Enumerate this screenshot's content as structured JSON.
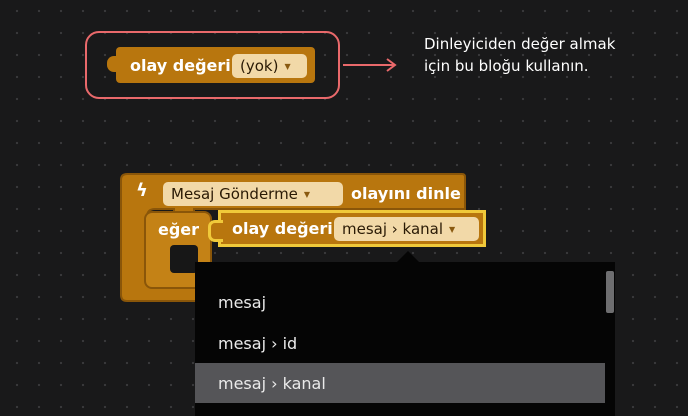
{
  "hint": {
    "block_label": "olay değeri",
    "block_value": "(yok)",
    "help_text": "Dinleyiciden değer almak için bu bloğu kullanın."
  },
  "event_block": {
    "event_name": "Mesaj Gönderme",
    "event_suffix": "olayını dinle",
    "if_label": "eğer",
    "value_label": "olay değeri",
    "value_selected": "mesaj › kanal"
  },
  "dropdown": {
    "options": [
      "mesaj",
      "mesaj › id",
      "mesaj › kanal"
    ],
    "selected_index": 2
  },
  "colors": {
    "block": "#b8760e",
    "block_dark": "#8a5609",
    "field": "#f2d9a8",
    "highlight_outline": "#f0c93a",
    "hint_outline": "#e9696b",
    "menu_bg": "#050505",
    "menu_selected": "#555558"
  }
}
